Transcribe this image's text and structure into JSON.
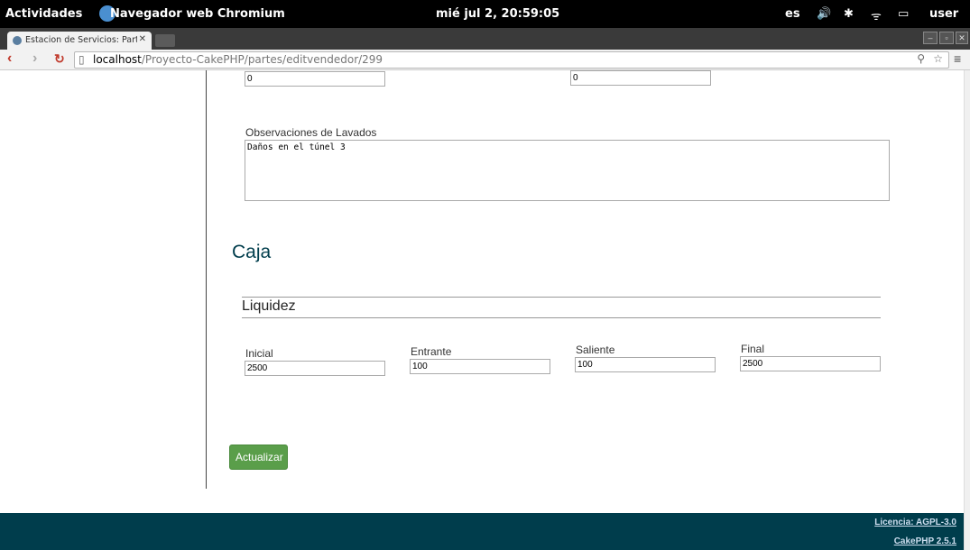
{
  "topbar": {
    "activities": "Actividades",
    "app_name": "Navegador web Chromium",
    "clock": "mié jul  2, 20:59:05",
    "lang": "es",
    "user": "user"
  },
  "browser": {
    "tab_title": "Estacion de Servicios: Part",
    "url_host": "localhost",
    "url_path": "/Proyecto-CakePHP/partes/editvendedor/299"
  },
  "form": {
    "top_field_1_value": "0",
    "top_field_2_value": "0",
    "observaciones_label": "Observaciones de Lavados",
    "observaciones_value": "Daños en el túnel 3",
    "section_title": "Caja",
    "fieldset_title": "Liquidez",
    "fields": [
      {
        "label": "Inicial",
        "value": "2500"
      },
      {
        "label": "Entrante",
        "value": "100"
      },
      {
        "label": "Saliente",
        "value": "100"
      },
      {
        "label": "Final",
        "value": "2500"
      }
    ],
    "submit_label": "Actualizar"
  },
  "footer": {
    "license": "Licencia: AGPL-3.0",
    "version": "CakePHP 2.5.1"
  }
}
